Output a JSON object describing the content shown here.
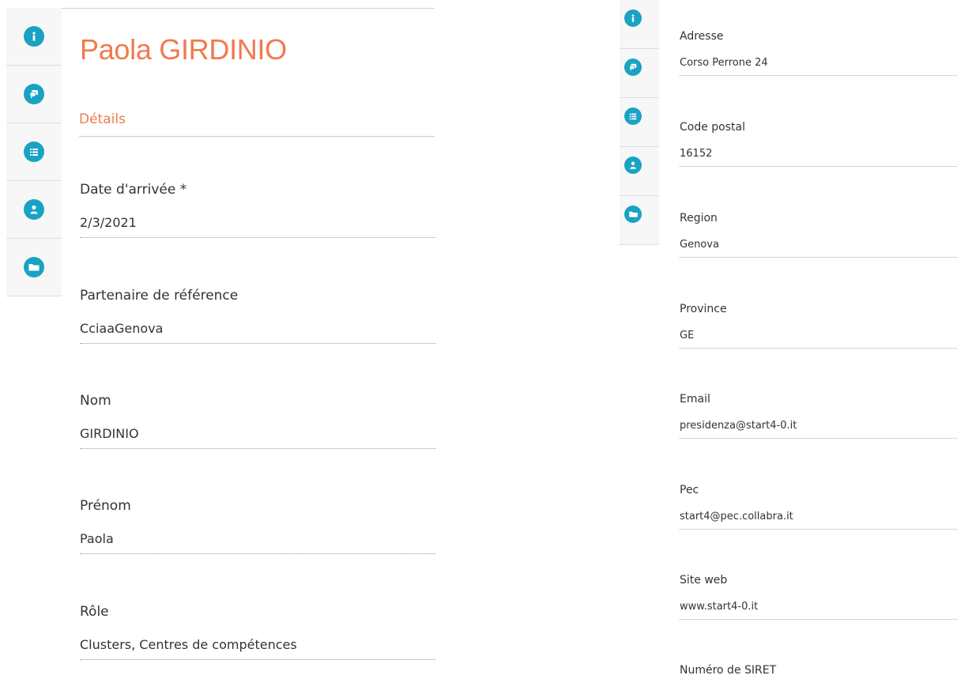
{
  "colors": {
    "accent": "#f07a4f",
    "icon_teal": "#1aa2c3"
  },
  "left_panel": {
    "title": "Paola GIRDINIO",
    "section": "Détails",
    "rail_icons": [
      "info-icon",
      "chat-bubble-icon",
      "list-icon",
      "user-icon",
      "folder-icon"
    ],
    "fields": [
      {
        "label": "Date d'arrivée *",
        "value": "2/3/2021"
      },
      {
        "label": "Partenaire de référence",
        "value": "CciaaGenova"
      },
      {
        "label": "Nom",
        "value": "GIRDINIO"
      },
      {
        "label": "Prénom",
        "value": "Paola"
      },
      {
        "label": "Rôle",
        "value": "Clusters, Centres de compétences"
      }
    ]
  },
  "right_panel": {
    "rail_icons": [
      "info-icon",
      "chat-bubble-icon",
      "list-icon",
      "user-icon",
      "folder-icon"
    ],
    "fields": [
      {
        "label": "Adresse",
        "value": "Corso Perrone 24"
      },
      {
        "label": "Code postal",
        "value": "16152"
      },
      {
        "label": "Region",
        "value": "Genova"
      },
      {
        "label": "Province",
        "value": "GE"
      },
      {
        "label": "Email",
        "value": "presidenza@start4-0.it"
      },
      {
        "label": "Pec",
        "value": "start4@pec.collabra.it"
      },
      {
        "label": "Site web",
        "value": "www.start4-0.it"
      },
      {
        "label": "Numéro de SIRET",
        "value": ""
      }
    ]
  }
}
